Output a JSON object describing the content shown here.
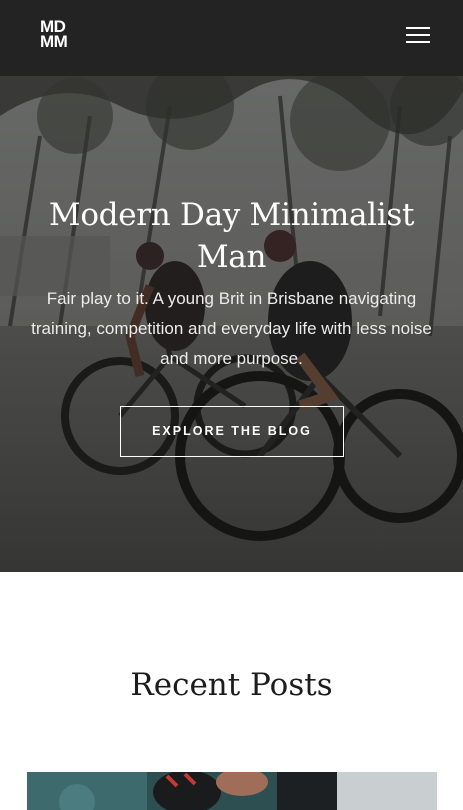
{
  "header": {
    "logo_line1": "MD",
    "logo_line2": "MM",
    "menu_icon": "hamburger-menu-icon"
  },
  "hero": {
    "title": "Modern Day Minimalist Man",
    "subtitle": "Fair play to it. A young Brit in Brisbane navigating training, competition and everyday life with less noise and more purpose.",
    "cta_label": "EXPLORE THE BLOG"
  },
  "recent": {
    "heading": "Recent Posts"
  },
  "colors": {
    "header_bg": "#232323",
    "hero_text": "#ffffff",
    "heading_text": "#1c1c1c"
  }
}
